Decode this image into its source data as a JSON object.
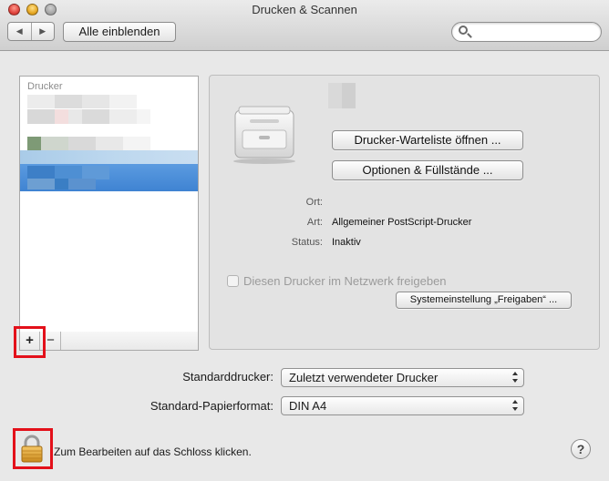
{
  "window": {
    "title": "Drucken & Scannen"
  },
  "toolbar": {
    "back_icon": "◀",
    "forward_icon": "▶",
    "show_all_label": "Alle einblenden",
    "search_placeholder": "",
    "search_value": ""
  },
  "printer_list": {
    "header": "Drucker",
    "add_label": "+",
    "remove_label": "−"
  },
  "detail": {
    "open_queue_label": "Drucker-Warteliste öffnen ...",
    "options_label": "Optionen & Füllstände ...",
    "location_label": "Ort:",
    "location_value": "",
    "kind_label": "Art:",
    "kind_value": "Allgemeiner PostScript-Drucker",
    "status_label": "Status:",
    "status_value": "Inaktiv",
    "share_label": "Diesen Drucker im Netzwerk freigeben",
    "sharing_prefs_label": "Systemeinstellung „Freigaben“ ..."
  },
  "defaults": {
    "default_printer_label": "Standarddrucker:",
    "default_printer_value": "Zuletzt verwendeter Drucker",
    "paper_size_label": "Standard-Papierformat:",
    "paper_size_value": "DIN A4"
  },
  "footer": {
    "lock_label": "Zum Bearbeiten auf das Schloss klicken.",
    "help_label": "?"
  },
  "colors": {
    "selection_blue": "#4a90d9",
    "highlight_red": "#e3101a"
  }
}
